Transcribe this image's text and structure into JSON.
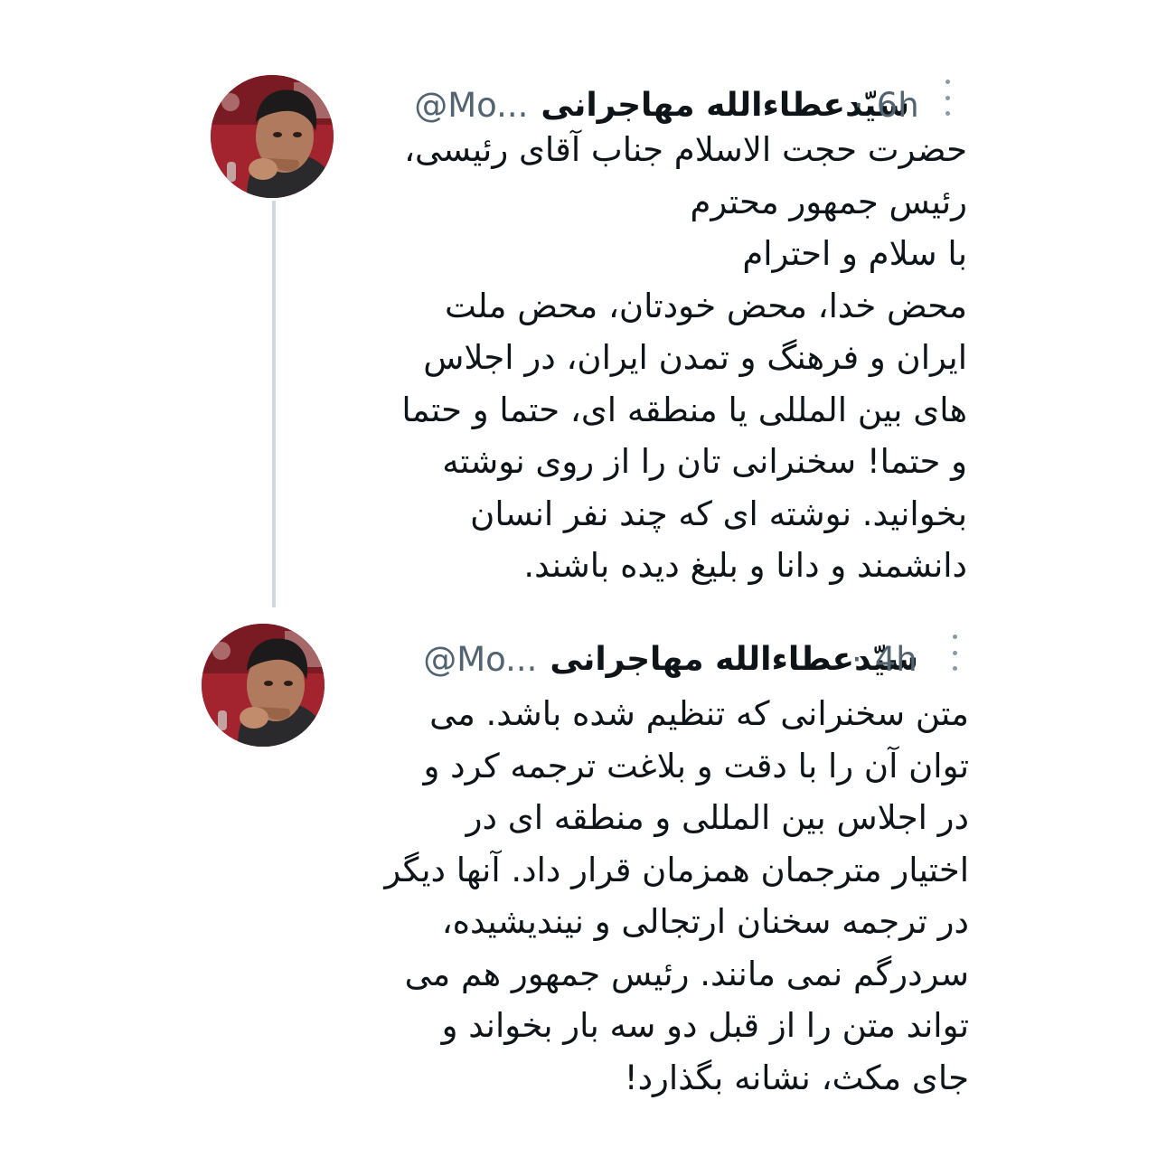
{
  "tweets": [
    {
      "display_name": "سیّدعطاءالله مهاجرانی",
      "handle": "@Mo...",
      "separator": "·",
      "time": "6h",
      "more_icon": "more-vertical-icon",
      "lines": [
        "حضرت حجت الاسلام جناب آقای رئیسی،",
        "رئیس جمهور محترم",
        "با سلام و احترام",
        "محض خدا، محض خودتان، محض ملت",
        "ایران و فرهنگ و تمدن ایران، در اجلاس",
        "های بین المللی یا منطقه ای، حتما و حتما",
        "و حتما! سخنرانی تان را از روی نوشته",
        "بخوانید. نوشته ای که چند نفر انسان",
        "دانشمند و دانا و بلیغ دیده باشند."
      ]
    },
    {
      "display_name": "سیّدعطاءالله مهاجرانی",
      "handle": "@Mo...",
      "separator": "·",
      "time": "4h",
      "more_icon": "more-vertical-icon",
      "lines": [
        "متن سخنرانی که تنظیم شده باشد. می",
        "توان آن را با دقت و بلاغت ترجمه کرد و",
        "در اجلاس بین المللی و منطقه ای در",
        "اختیار مترجمان همزمان قرار داد. آنها دیگر",
        "در ترجمه سخنان ارتجالی و نیندیشیده،",
        "سردرگم نمی مانند. رئیس جمهور هم می",
        "تواند متن را از قبل دو سه بار بخواند و",
        "جای مکث، نشانه بگذارد!"
      ]
    }
  ],
  "colors": {
    "text": "#0f1419",
    "secondary": "#536471",
    "thread_line": "#cfd9de",
    "background": "#ffffff"
  }
}
